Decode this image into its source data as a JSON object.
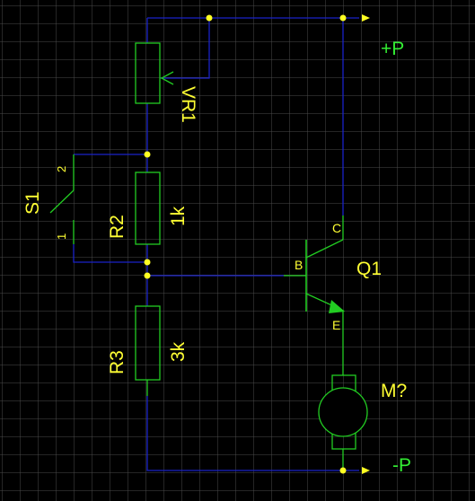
{
  "colors": {
    "background": "#000000",
    "grid": "#4a4a4a",
    "wire": "#1a22c8",
    "component": "#22cc22",
    "label": "#ffff33",
    "power_label": "#33ee33",
    "junction": "#ffff22"
  },
  "components": {
    "vr1": {
      "ref": "VR1"
    },
    "r2": {
      "ref": "R2",
      "value": "1k"
    },
    "r3": {
      "ref": "R3",
      "value": "3k"
    },
    "s1": {
      "ref": "S1",
      "pin1": "1",
      "pin2": "2"
    },
    "q1": {
      "ref": "Q1",
      "pin_b": "B",
      "pin_c": "C",
      "pin_e": "E"
    },
    "motor": {
      "ref": "M?"
    }
  },
  "power": {
    "positive": "+P",
    "negative": "-P"
  }
}
